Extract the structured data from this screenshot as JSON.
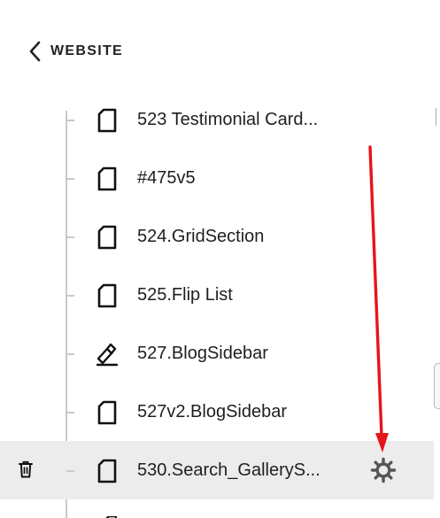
{
  "nav": {
    "back_label": "WEBSITE"
  },
  "pages": [
    {
      "label": "523 Testimonial Card...",
      "icon": "page-icon"
    },
    {
      "label": "#475v5",
      "icon": "page-icon"
    },
    {
      "label": "524.GridSection",
      "icon": "page-icon"
    },
    {
      "label": "525.Flip List",
      "icon": "page-icon"
    },
    {
      "label": "527.BlogSidebar",
      "icon": "page-edit-icon"
    },
    {
      "label": "527v2.BlogSidebar",
      "icon": "page-icon"
    },
    {
      "label": "530.Search_GalleryS...",
      "icon": "page-icon",
      "active": true
    }
  ],
  "colors": {
    "annotation_arrow": "#e8141b",
    "active_row_bg": "#ececec",
    "tree_line": "#c9c9c9"
  }
}
